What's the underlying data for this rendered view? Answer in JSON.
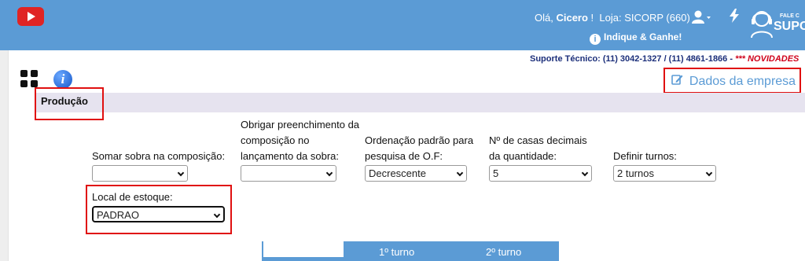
{
  "header": {
    "greeting_prefix": "Olá, ",
    "user_name": "Cicero",
    "greeting_suffix": " !",
    "store": "Loja: SICORP (660)",
    "indique": "Indique & Ganhe!",
    "fale": "FALE C",
    "suporte": "SUPOR"
  },
  "support_line": {
    "text": "Suporte Técnico: (11) 3042-1327 / (11) 4861-1866 - ",
    "novidades": "*** NOVIDADES"
  },
  "dados_link": "Dados da empresa",
  "section_title": "Produção",
  "fields": {
    "somar": {
      "label": "Somar sobra na composição:",
      "value": ""
    },
    "obrigar": {
      "label_lines": [
        "Obrigar preenchimento da",
        "composição no",
        "lançamento da sobra:"
      ],
      "value": ""
    },
    "ordenacao": {
      "label_lines": [
        "Ordenação padrão para",
        "pesquisa de O.F:"
      ],
      "value": "Decrescente"
    },
    "casas": {
      "label_lines": [
        "Nº de casas decimais",
        "da quantidade:"
      ],
      "value": "5"
    },
    "turnos": {
      "label": "Definir turnos:",
      "value": "2 turnos"
    },
    "local": {
      "label": "Local de estoque:",
      "value": "PADRAO"
    }
  },
  "turnos_table": {
    "col1": "1º turno",
    "col2": "2º turno"
  },
  "colors": {
    "topbar": "#5b9bd5",
    "highlight": "#e01010",
    "section_bar": "#e6e3ef",
    "support_text": "#1c2f7a",
    "novidades": "#d0021b"
  },
  "icons": [
    "youtube-icon",
    "user-icon",
    "bolt-icon",
    "support-agent-icon",
    "info-icon",
    "grid-icon",
    "edit-icon",
    "chevron-down-icon"
  ]
}
